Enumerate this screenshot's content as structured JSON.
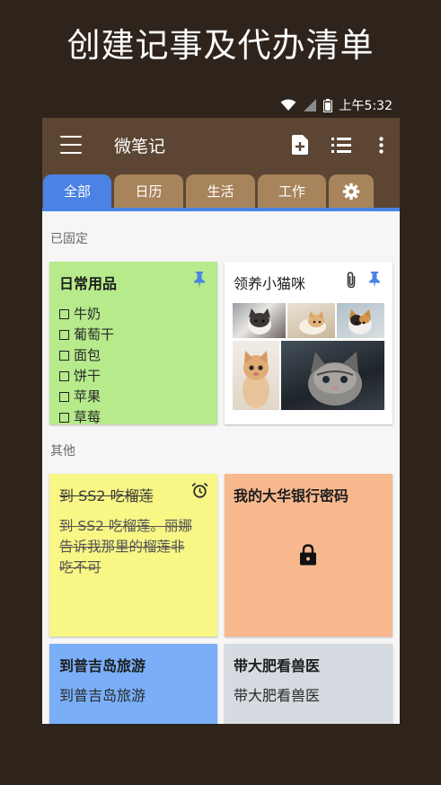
{
  "promo": {
    "headline": "创建记事及代办清单"
  },
  "status_bar": {
    "time": "上午5:32"
  },
  "app_bar": {
    "title": "微笔记",
    "icons": [
      "menu-icon",
      "new-note-icon",
      "list-view-icon",
      "more-vert-icon"
    ]
  },
  "tabs": [
    {
      "label": "全部",
      "active": true
    },
    {
      "label": "日历",
      "active": false
    },
    {
      "label": "生活",
      "active": false
    },
    {
      "label": "工作",
      "active": false
    }
  ],
  "sections": {
    "pinned": "已固定",
    "others": "其他"
  },
  "notes": {
    "daily": {
      "title": "日常用品",
      "color": "#b6ea8b",
      "items": [
        "牛奶",
        "葡萄干",
        "面包",
        "饼干",
        "苹果",
        "草莓"
      ]
    },
    "cats": {
      "title": "领养小猫咪",
      "color": "#ffffff"
    },
    "durian": {
      "title": "到 SS2 吃榴莲",
      "body_lines": [
        "到 SS2 吃榴莲。丽娜",
        "告诉我那里的榴莲非",
        "吃不可"
      ],
      "color": "#f8f685"
    },
    "bank": {
      "title": "我的大华银行密码",
      "color": "#f7b88e"
    },
    "phuket": {
      "title": "到普吉岛旅游",
      "body": "到普吉岛旅游",
      "color": "#7aaff8"
    },
    "vet": {
      "title": "带大肥看兽医",
      "body": "带大肥看兽医",
      "color": "#d5dbe1"
    }
  },
  "colors": {
    "accent": "#4a83e4",
    "appbar": "#5c4633",
    "tab_inactive": "#a8845c",
    "pin": "#4a83e4"
  }
}
